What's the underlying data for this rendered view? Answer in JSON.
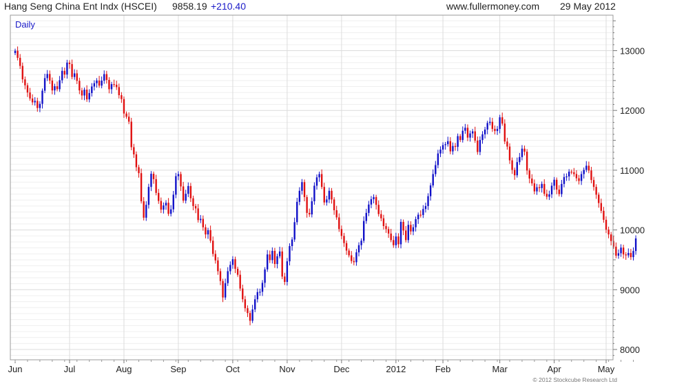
{
  "header": {
    "title": "Hang Seng China Ent Indx (HSCEI)",
    "last": "9858.19",
    "change": "+210.40",
    "site": "www.fullermoney.com",
    "date": "29 May 2012"
  },
  "panel_label": "Daily",
  "copyright": "© 2012 Stockcube Research Ltd",
  "colors": {
    "up": "#1010c8",
    "down": "#e01010",
    "grid": "#dcdcdc",
    "minor_grid": "#efefef",
    "frame": "#999999",
    "label_blue": "#1a1ac8"
  },
  "chart_data": {
    "type": "candlestick",
    "period": "Daily",
    "y_axis_position": "right",
    "ylim": [
      7850,
      13600
    ],
    "yticks": [
      8000,
      9000,
      10000,
      11000,
      12000,
      13000
    ],
    "grid": true,
    "x_labels": [
      "Jun",
      "Jul",
      "Aug",
      "Sep",
      "Oct",
      "Nov",
      "Dec",
      "2012",
      "Feb",
      "Mar",
      "Apr",
      "May"
    ],
    "label_day_index": [
      0,
      22,
      44,
      66,
      88,
      110,
      132,
      154,
      173,
      196,
      218,
      239
    ],
    "last_close": 9858.19,
    "closes": [
      12998,
      12880,
      12745,
      12520,
      12420,
      12300,
      12200,
      12135,
      12160,
      12040,
      12110,
      12330,
      12540,
      12610,
      12500,
      12335,
      12405,
      12355,
      12505,
      12662,
      12600,
      12800,
      12775,
      12560,
      12620,
      12495,
      12335,
      12250,
      12348,
      12185,
      12290,
      12400,
      12455,
      12500,
      12415,
      12498,
      12608,
      12510,
      12355,
      12440,
      12430,
      12390,
      12255,
      12190,
      11948,
      11895,
      11812,
      11385,
      11265,
      11050,
      10950,
      10480,
      10205,
      10420,
      10720,
      10940,
      10850,
      10620,
      10485,
      10340,
      10410,
      10455,
      10270,
      10345,
      10590,
      10900,
      10935,
      10728,
      10490,
      10605,
      10735,
      10530,
      10400,
      10360,
      10165,
      10185,
      10045,
      9925,
      9995,
      9820,
      9598,
      9490,
      9310,
      9145,
      8870,
      9110,
      9310,
      9415,
      9510,
      9350,
      9250,
      9020,
      8840,
      8690,
      8610,
      8480,
      8670,
      8840,
      8960,
      8965,
      9115,
      9340,
      9590,
      9495,
      9650,
      9430,
      9560,
      9640,
      9220,
      9130,
      9475,
      9730,
      9840,
      10130,
      10470,
      10655,
      10800,
      10550,
      10285,
      10260,
      10480,
      10740,
      10880,
      10935,
      10720,
      10460,
      10510,
      10655,
      10510,
      10330,
      10210,
      10015,
      9900,
      9780,
      9655,
      9575,
      9480,
      9460,
      9625,
      9745,
      9820,
      10150,
      10285,
      10425,
      10515,
      10550,
      10420,
      10265,
      10195,
      10065,
      10015,
      9940,
      9830,
      9745,
      9890,
      9760,
      10135,
      9990,
      9830,
      10085,
      9975,
      10045,
      10180,
      10255,
      10250,
      10350,
      10400,
      10565,
      10745,
      10935,
      11085,
      11280,
      11345,
      11420,
      11435,
      11485,
      11315,
      11405,
      11390,
      11570,
      11505,
      11660,
      11710,
      11545,
      11615,
      11650,
      11495,
      11305,
      11505,
      11600,
      11680,
      11790,
      11810,
      11690,
      11655,
      11690,
      11885,
      11780,
      11480,
      11395,
      11165,
      11005,
      10915,
      11135,
      11220,
      11360,
      11310,
      10995,
      10860,
      10780,
      10645,
      10715,
      10700,
      10770,
      10605,
      10555,
      10595,
      10740,
      10840,
      10675,
      10600,
      10770,
      10885,
      10895,
      10975,
      10965,
      10935,
      10865,
      10820,
      10935,
      11005,
      11075,
      10995,
      10835,
      10720,
      10590,
      10450,
      10320,
      10170,
      10005,
      9925,
      9815,
      9720,
      9570,
      9610,
      9705,
      9590,
      9575,
      9615,
      9545,
      9648,
      9858
    ]
  }
}
